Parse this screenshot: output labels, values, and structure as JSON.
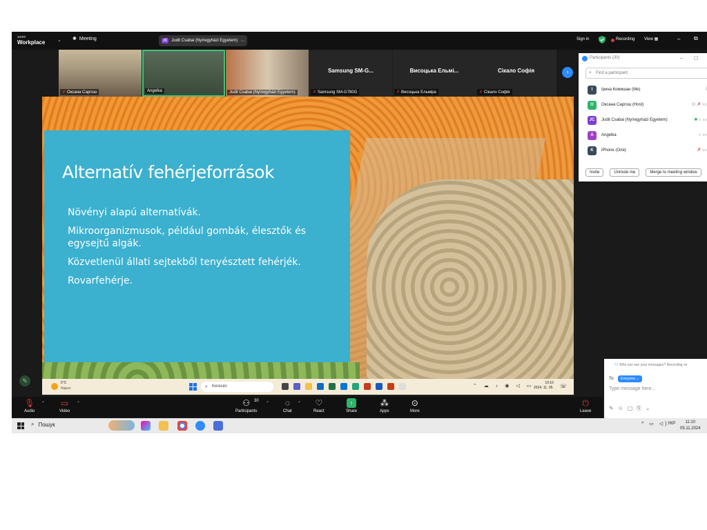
{
  "zoom": {
    "logo_small": "zoom",
    "logo_big": "Workplace",
    "meeting_label": "Meeting",
    "active_speaker_badge": "JC",
    "active_speaker": "Judit Csabai (Nyíregyházi Egyetem)",
    "signin": "Sign in",
    "recording": "Recording",
    "view": "View"
  },
  "video_tiles": [
    {
      "name": "Оксана Саргош",
      "big_name": ""
    },
    {
      "name": "Angelka",
      "big_name": ""
    },
    {
      "name": "Judit Csabai (Nyíregyházi Egyetem)",
      "big_name": ""
    },
    {
      "name": "Samsung SM-G780G",
      "big_name": "Samsung  SM-G..."
    },
    {
      "name": "Висоцька Ельміра",
      "big_name": "Висоцька  Ельмі..."
    },
    {
      "name": "Сікало Софія",
      "big_name": "Сікало Софія"
    }
  ],
  "slide": {
    "title": "Alternatív fehérjeforrások",
    "bullets": [
      "Növényi alapú alternatívák.",
      "Mikroorganizmusok, például gombák, élesztők és egysejtű algák.",
      "Közvetlenül állati sejtekből tenyésztett fehérjék.",
      "Rovarfehérje."
    ]
  },
  "shared_taskbar": {
    "temp": "5°C",
    "weather": "Napos",
    "search_placeholder": "Keresés",
    "time": "10:10",
    "date": "2024. 11. 05."
  },
  "toolbar": {
    "audio": "Audio",
    "video": "Video",
    "participants": "Participants",
    "participants_count": "30",
    "chat": "Chat",
    "react": "React",
    "share": "Share",
    "apps": "Apps",
    "more": "More",
    "leave": "Leave"
  },
  "participants_panel": {
    "title": "Participants (30)",
    "search_placeholder": "Find a participant",
    "rows": [
      {
        "initial": "I",
        "name": "Ірина Комишан (Me)",
        "color": "#3a4a5a"
      },
      {
        "initial": "O",
        "name": "Оксана Саргош (Host)",
        "color": "#2fb36a"
      },
      {
        "initial": "JC",
        "name": "Judit Csabai (Nyíregyházi Egyetem)",
        "color": "#7b3fd4"
      },
      {
        "initial": "A",
        "name": "Angelka",
        "color": "#a040c8"
      },
      {
        "initial": "K",
        "name": "iPhone (Оля)",
        "color": "#3a4a5a"
      }
    ],
    "invite": "Invite",
    "unmute_me": "Unmute me",
    "merge": "Merge to meeting window"
  },
  "chat_panel": {
    "who_can_see": "Who can see your messages? Recording on",
    "to_label": "To:",
    "to_value": "Everyone",
    "input_placeholder": "Type message here..."
  },
  "os_taskbar": {
    "search_label": "Пошук",
    "lang": "УКР",
    "time": "11:10",
    "date": "05.11.2024"
  }
}
